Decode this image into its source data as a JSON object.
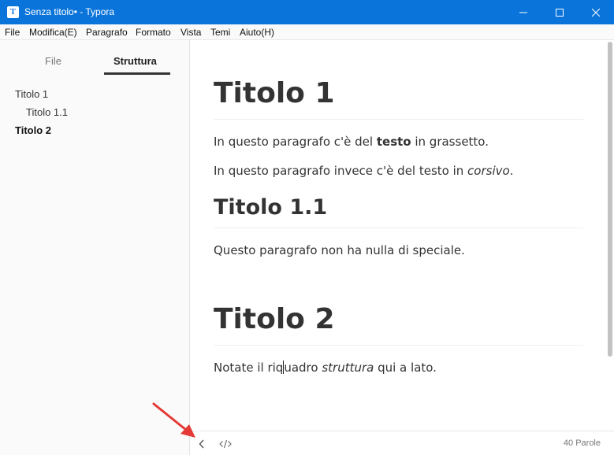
{
  "window": {
    "title": "Senza titolo• - Typora",
    "app_icon_letter": "T",
    "controls": [
      "minimize-icon",
      "maximize-icon",
      "close-icon"
    ]
  },
  "menu": [
    "File",
    "Modifica(E)",
    "Paragrafo",
    "Formato",
    "Vista",
    "Temi",
    "Aiuto(H)"
  ],
  "sidebar": {
    "tabs": [
      {
        "label": "File",
        "active": false
      },
      {
        "label": "Struttura",
        "active": true
      }
    ],
    "outline": [
      {
        "label": "Titolo 1",
        "level": 1
      },
      {
        "label": "Titolo 1.1",
        "level": 2
      },
      {
        "label": "Titolo 2",
        "level": 1,
        "active": true
      }
    ]
  },
  "document": {
    "h1_a": "Titolo 1",
    "p1": {
      "before": "In questo paragrafo c'è del ",
      "bold": "testo",
      "after": " in grassetto."
    },
    "p2": {
      "before": "In questo paragrafo invece c'è del testo in ",
      "italic": "corsivo",
      "after": "."
    },
    "h2": "Titolo 1.1",
    "p3": "Questo paragrafo non ha nulla di speciale.",
    "h1_b": "Titolo 2",
    "p4": {
      "before_caret": "Notate il riq",
      "after_caret": "uadro ",
      "italic": "struttura",
      "after": " qui a lato."
    }
  },
  "footer": {
    "word_count": "40 Parole",
    "icons": [
      "chevron-left-icon",
      "source-code-icon"
    ]
  },
  "colors": {
    "titlebar": "#0a74da",
    "annotation_arrow": "#e53935"
  }
}
